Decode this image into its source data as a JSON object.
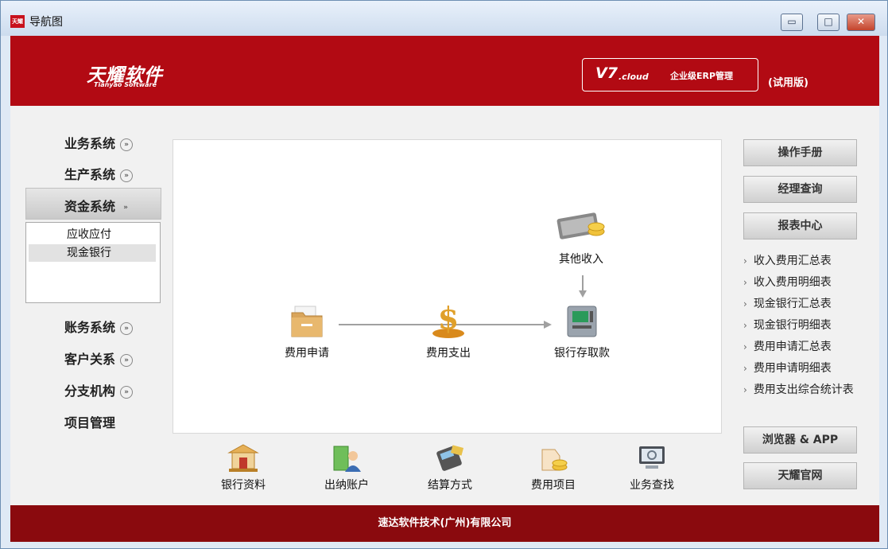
{
  "window": {
    "title": "导航图",
    "app_icon_text": "天耀",
    "minimize_glyph": "▭",
    "maximize_glyph": "□",
    "close_glyph": "✕"
  },
  "banner": {
    "brand_cn": "天耀软件",
    "brand_en": "Tianyao Software",
    "version_main": "V7",
    "version_sub": ".cloud",
    "version_text": "企业级ERP管理",
    "trial": "(试用版)"
  },
  "left_menu": {
    "items": [
      {
        "label": "业务系统",
        "chevron": "»"
      },
      {
        "label": "生产系统",
        "chevron": "»"
      },
      {
        "label": "资金系统",
        "chevron": "»"
      },
      {
        "label": "账务系统",
        "chevron": "»"
      },
      {
        "label": "客户关系",
        "chevron": "»"
      },
      {
        "label": "分支机构",
        "chevron": "»"
      },
      {
        "label": "项目管理"
      }
    ],
    "submenu": [
      "应收应付",
      "现金银行"
    ]
  },
  "flow": {
    "nodes": {
      "apply": "费用申请",
      "payout": "费用支出",
      "other_income": "其他收入",
      "bank": "银行存取款"
    }
  },
  "right_panel": {
    "buttons": {
      "manual": "操作手册",
      "manager": "经理查询",
      "report": "报表中心"
    },
    "links": [
      "收入费用汇总表",
      "收入费用明细表",
      "现金银行汇总表",
      "现金银行明细表",
      "费用申请汇总表",
      "费用申请明细表",
      "费用支出综合统计表"
    ],
    "link_arrow": "›",
    "browser": "浏览器 & APP",
    "website": "天耀官网"
  },
  "bottom_bar": [
    "银行资料",
    "出纳账户",
    "结算方式",
    "费用项目",
    "业务查找"
  ],
  "footer": {
    "text": "速达软件技术(广州)有限公司"
  },
  "colors": {
    "brand_red": "#b20a13",
    "footer_red": "#8a0a0e"
  }
}
